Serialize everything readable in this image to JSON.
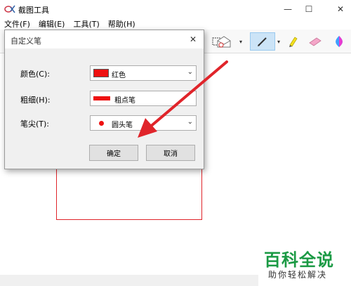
{
  "window": {
    "title": "截图工具",
    "minimize_glyph": "—",
    "maximize_glyph": "☐",
    "close_glyph": "✕"
  },
  "menu": {
    "items": [
      "文件(F)",
      "编辑(E)",
      "工具(T)",
      "帮助(H)"
    ]
  },
  "toolbar": {
    "icons": [
      "new-snip-icon",
      "send-email-icon",
      "pen-icon",
      "highlighter-icon",
      "eraser-icon",
      "paint3d-icon"
    ],
    "dropdown_glyph": "▾",
    "active_tool": "pen"
  },
  "dialog": {
    "title": "自定义笔",
    "close_glyph": "✕",
    "color_label": "颜色(C):",
    "color_value": "红色",
    "thickness_label": "粗细(H):",
    "thickness_value": "粗点笔",
    "tip_label": "笔尖(T):",
    "tip_value": "圆头笔",
    "combo_arrow": "⌄",
    "ok_label": "确定",
    "cancel_label": "取消"
  },
  "watermark": {
    "main": "百科全说",
    "sub": "助你轻松解决"
  },
  "colors": {
    "pen_red": "#ee1111",
    "annotation_red": "#e0242a",
    "watermark_green": "#1b9a44",
    "active_tool_bg": "#cce4f7"
  }
}
